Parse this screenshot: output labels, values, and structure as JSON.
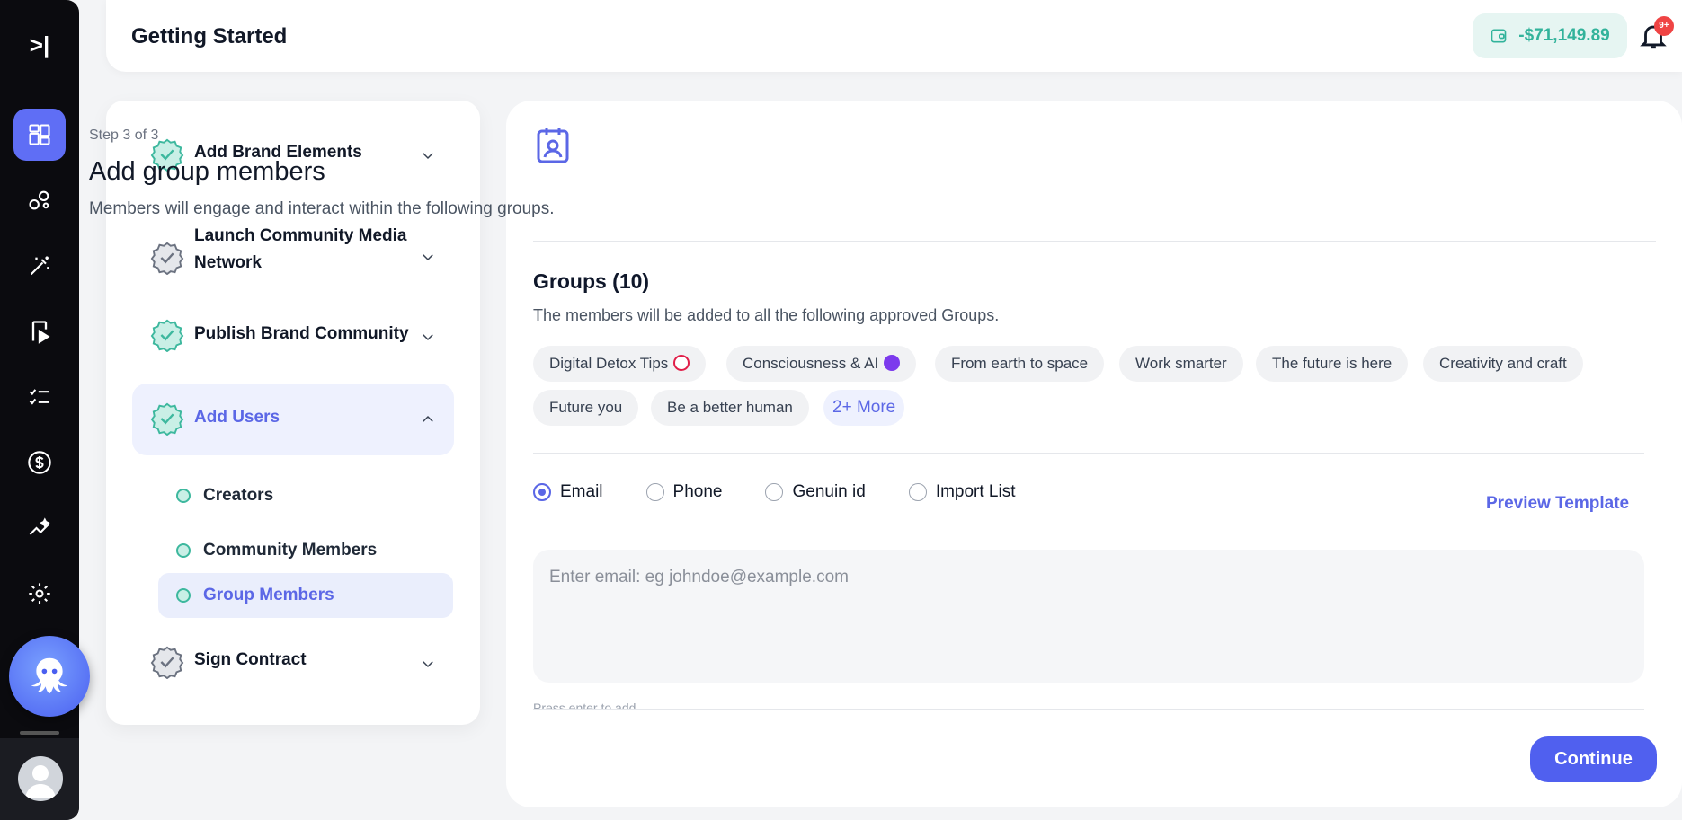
{
  "header": {
    "title": "Getting Started",
    "wallet_amount": "-$71,149.89",
    "notification_badge": "9+"
  },
  "sidebar": {
    "toggle_icon": ">|",
    "items": [
      {
        "icon": "dashboard-icon",
        "active": true
      },
      {
        "icon": "circles-icon"
      },
      {
        "icon": "magic-wand-icon"
      },
      {
        "icon": "video-page-icon"
      },
      {
        "icon": "checklist-icon"
      },
      {
        "icon": "dollar-icon"
      },
      {
        "icon": "analytics-icon"
      },
      {
        "icon": "settings-icon"
      }
    ]
  },
  "steps": [
    {
      "label": "Add Brand Elements",
      "done": true
    },
    {
      "label": "Launch Community Media Network",
      "done": false
    },
    {
      "label": "Publish Brand Community",
      "done": true
    },
    {
      "label": "Add Users",
      "done": true,
      "active": true,
      "children": [
        {
          "label": "Creators"
        },
        {
          "label": "Community Members"
        },
        {
          "label": "Group Members",
          "active": true
        }
      ]
    },
    {
      "label": "Sign Contract",
      "done": false
    }
  ],
  "main": {
    "step_count": "Step 3 of 3",
    "title": "Add group members",
    "description": "Members will engage and interact within the following groups.",
    "groups_title": "Groups (10)",
    "groups_description": "The members will be added to all the following approved Groups.",
    "groups": [
      "Digital Detox Tips",
      "Consciousness & AI",
      "From earth to space",
      "Work smarter",
      "The future is here",
      "Creativity and craft",
      "Future you",
      "Be a better human"
    ],
    "more_label": "2+ More",
    "input_types": [
      "Email",
      "Phone",
      "Genuin id",
      "Import List"
    ],
    "selected_input_type": "Email",
    "preview_label": "Preview Template",
    "email_placeholder": "Enter email: eg johndoe@example.com",
    "hint": "Press enter to add",
    "continue_label": "Continue"
  },
  "colors": {
    "accent": "#5060ef",
    "teal": "#32b39b",
    "rail": "#0b0b0f"
  }
}
